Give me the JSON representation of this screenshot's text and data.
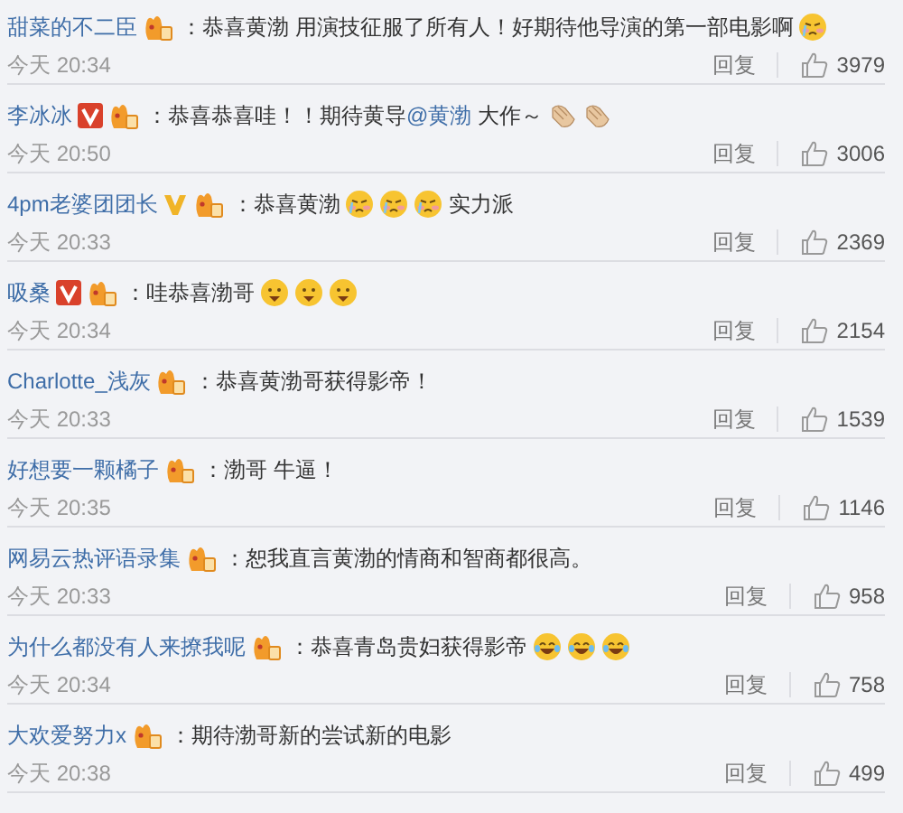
{
  "comments": [
    {
      "user": "甜菜的不二臣",
      "badges": [
        {
          "kind": "member"
        }
      ],
      "parts": [
        {
          "kind": "text",
          "runs": [
            {
              "text": "：恭喜黄渤 用演技征服了所有人！好期待他导演的第一部电影啊"
            }
          ]
        },
        {
          "kind": "crying"
        }
      ],
      "time": "今天 20:34",
      "reply": "回复",
      "likes": "3979"
    },
    {
      "user": "李冰冰",
      "badges": [
        {
          "kind": "verified"
        },
        {
          "kind": "member"
        }
      ],
      "parts": [
        {
          "kind": "text",
          "runs": [
            {
              "text": "：恭喜恭喜哇！！期待黄导"
            },
            {
              "text": "@黄渤",
              "kind": "mention"
            },
            {
              "text": " 大作～"
            }
          ]
        },
        {
          "kind": "clap"
        },
        {
          "kind": "clap"
        }
      ],
      "time": "今天 20:50",
      "reply": "回复",
      "likes": "3006"
    },
    {
      "user": "4pm老婆团团长",
      "badges": [
        {
          "kind": "vip"
        },
        {
          "kind": "member"
        }
      ],
      "parts": [
        {
          "kind": "text",
          "runs": [
            {
              "text": "：恭喜黄渤"
            }
          ]
        },
        {
          "kind": "crying"
        },
        {
          "kind": "crying"
        },
        {
          "kind": "crying"
        },
        {
          "kind": "text",
          "runs": [
            {
              "text": "实力派"
            }
          ]
        }
      ],
      "time": "今天 20:33",
      "reply": "回复",
      "likes": "2369"
    },
    {
      "user": "吸桑",
      "badges": [
        {
          "kind": "verified"
        },
        {
          "kind": "member"
        }
      ],
      "parts": [
        {
          "kind": "text",
          "runs": [
            {
              "text": "：哇恭喜渤哥"
            }
          ]
        },
        {
          "kind": "drool"
        },
        {
          "kind": "drool"
        },
        {
          "kind": "drool"
        }
      ],
      "time": "今天 20:34",
      "reply": "回复",
      "likes": "2154"
    },
    {
      "user": "Charlotte_浅灰",
      "badges": [
        {
          "kind": "member"
        }
      ],
      "parts": [
        {
          "kind": "text",
          "runs": [
            {
              "text": "：恭喜黄渤哥获得影帝！"
            }
          ]
        }
      ],
      "time": "今天 20:33",
      "reply": "回复",
      "likes": "1539"
    },
    {
      "user": "好想要一颗橘子",
      "badges": [
        {
          "kind": "member"
        }
      ],
      "parts": [
        {
          "kind": "text",
          "runs": [
            {
              "text": "：渤哥 牛逼！"
            }
          ]
        }
      ],
      "time": "今天 20:35",
      "reply": "回复",
      "likes": "1146"
    },
    {
      "user": "网易云热评语录集",
      "badges": [
        {
          "kind": "member"
        }
      ],
      "parts": [
        {
          "kind": "text",
          "runs": [
            {
              "text": "：恕我直言黄渤的情商和智商都很高。"
            }
          ]
        }
      ],
      "time": "今天 20:33",
      "reply": "回复",
      "likes": "958"
    },
    {
      "user": "为什么都没有人来撩我呢",
      "badges": [
        {
          "kind": "member"
        }
      ],
      "parts": [
        {
          "kind": "text",
          "runs": [
            {
              "text": "：恭喜青岛贵妇获得影帝"
            }
          ]
        },
        {
          "kind": "laugh"
        },
        {
          "kind": "laugh"
        },
        {
          "kind": "laugh"
        }
      ],
      "time": "今天 20:34",
      "reply": "回复",
      "likes": "758"
    },
    {
      "user": "大欢爱努力x",
      "badges": [
        {
          "kind": "member"
        }
      ],
      "parts": [
        {
          "kind": "text",
          "runs": [
            {
              "text": "：期待渤哥新的尝试新的电影"
            }
          ]
        }
      ],
      "time": "今天 20:38",
      "reply": "回复",
      "likes": "499"
    }
  ]
}
